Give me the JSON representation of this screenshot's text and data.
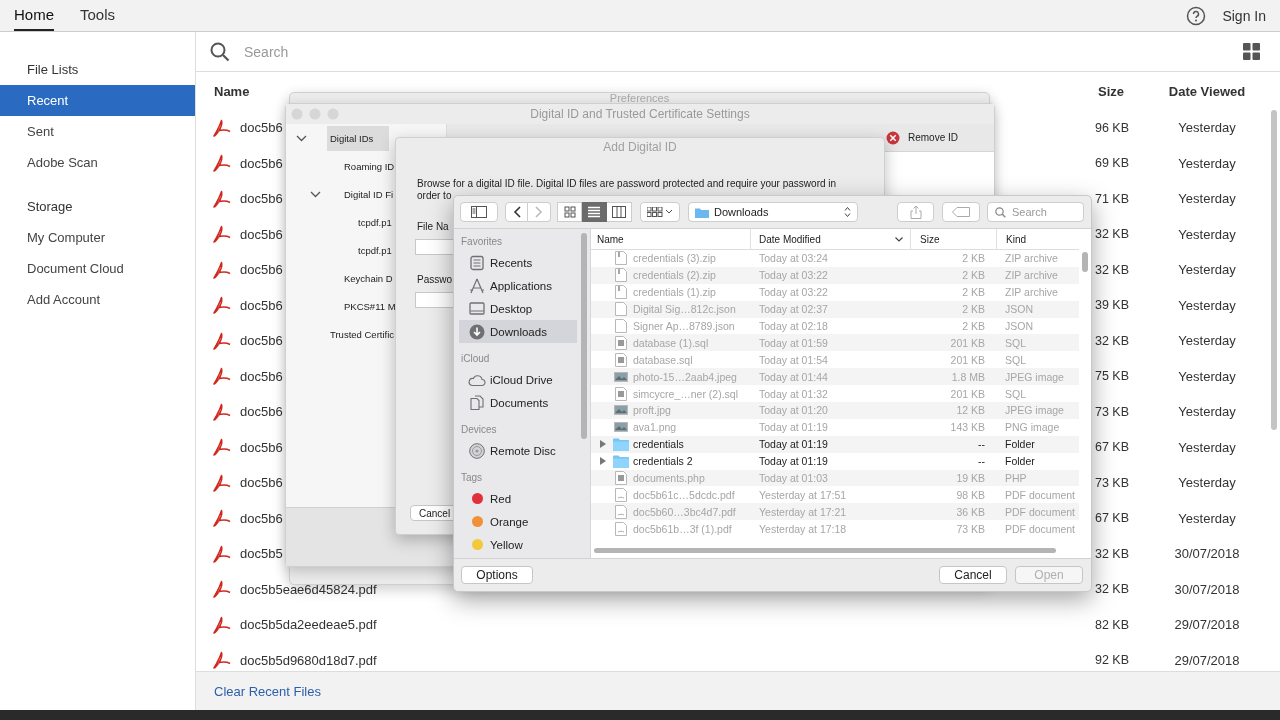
{
  "app": {
    "tabs": [
      {
        "label": "Home",
        "selected": true
      },
      {
        "label": "Tools",
        "selected": false
      }
    ],
    "sign_in": "Sign In"
  },
  "sidebar": {
    "sections": [
      {
        "title": "File Lists",
        "items": [
          {
            "label": "Recent",
            "selected": true
          },
          {
            "label": "Sent",
            "selected": false
          },
          {
            "label": "Adobe Scan",
            "selected": false
          }
        ]
      },
      {
        "title": "Storage",
        "items": [
          {
            "label": "My Computer",
            "selected": false
          },
          {
            "label": "Document Cloud",
            "selected": false
          },
          {
            "label": "Add Account",
            "selected": false
          }
        ]
      }
    ]
  },
  "search": {
    "placeholder": "Search"
  },
  "file_table": {
    "columns": [
      "Name",
      "Size",
      "Date Viewed"
    ],
    "rows": [
      {
        "name": "doc5b6",
        "size": "96 KB",
        "date": "Yesterday"
      },
      {
        "name": "doc5b6",
        "size": "69 KB",
        "date": "Yesterday"
      },
      {
        "name": "doc5b6",
        "size": "71 KB",
        "date": "Yesterday"
      },
      {
        "name": "doc5b6",
        "size": "32 KB",
        "date": "Yesterday"
      },
      {
        "name": "doc5b6",
        "size": "32 KB",
        "date": "Yesterday"
      },
      {
        "name": "doc5b6",
        "size": "39 KB",
        "date": "Yesterday"
      },
      {
        "name": "doc5b6",
        "size": "32 KB",
        "date": "Yesterday"
      },
      {
        "name": "doc5b6",
        "size": "75 KB",
        "date": "Yesterday"
      },
      {
        "name": "doc5b6",
        "size": "73 KB",
        "date": "Yesterday"
      },
      {
        "name": "doc5b6",
        "size": "67 KB",
        "date": "Yesterday"
      },
      {
        "name": "doc5b6",
        "size": "73 KB",
        "date": "Yesterday"
      },
      {
        "name": "doc5b6",
        "size": "67 KB",
        "date": "Yesterday"
      },
      {
        "name": "doc5b5",
        "size": "32 KB",
        "date": "30/07/2018"
      },
      {
        "name": "doc5b5eae6d45824.pdf",
        "size": "32 KB",
        "date": "30/07/2018"
      },
      {
        "name": "doc5b5da2eedeae5.pdf",
        "size": "82 KB",
        "date": "29/07/2018"
      },
      {
        "name": "doc5b5d9680d18d7.pdf",
        "size": "92 KB",
        "date": "29/07/2018"
      }
    ]
  },
  "footer_link": "Clear Recent Files",
  "preferences_window": {
    "title": "Preferences"
  },
  "certificate_window": {
    "title": "Digital ID and Trusted Certificate Settings",
    "toolbar": [
      {
        "label": "Remove ID"
      }
    ],
    "tree": [
      {
        "label": "Digital IDs",
        "selected": true,
        "expanded": true,
        "children": [
          {
            "label": "Roaming ID",
            "selected": false
          },
          {
            "label": "Digital ID Fi",
            "selected": false,
            "expanded": true,
            "children": [
              {
                "label": "tcpdf.p1",
                "selected": false
              },
              {
                "label": "tcpdf.p1",
                "selected": false
              }
            ]
          },
          {
            "label": "Keychain D",
            "selected": false
          },
          {
            "label": "PKCS#11 M",
            "selected": false
          }
        ]
      },
      {
        "label": "Trusted Certific",
        "selected": false
      }
    ]
  },
  "add_id_dialog": {
    "title": "Add Digital ID",
    "description": "Browse for a digital ID file. Digital ID files are password protected and require your password in order to",
    "fields": [
      {
        "label": "File Na"
      },
      {
        "label": "Passwo"
      }
    ],
    "cancel": "Cancel"
  },
  "file_dialog": {
    "views": [
      {
        "kind": "icon",
        "selected": false
      },
      {
        "kind": "list",
        "selected": true
      },
      {
        "kind": "column",
        "selected": false
      }
    ],
    "location": "Downloads",
    "search_placeholder": "Search",
    "sidebar": [
      {
        "title": "Favorites",
        "items": [
          {
            "label": "Recents",
            "kind": "recents",
            "selected": false
          },
          {
            "label": "Applications",
            "kind": "applications",
            "selected": false
          },
          {
            "label": "Desktop",
            "kind": "desktop",
            "selected": false
          },
          {
            "label": "Downloads",
            "kind": "downloads",
            "selected": true
          }
        ]
      },
      {
        "title": "iCloud",
        "items": [
          {
            "label": "iCloud Drive",
            "kind": "cloud",
            "selected": false
          },
          {
            "label": "Documents",
            "kind": "documents",
            "selected": false
          }
        ]
      },
      {
        "title": "Devices",
        "items": [
          {
            "label": "Remote Disc",
            "kind": "disc",
            "selected": false
          }
        ]
      },
      {
        "title": "Tags",
        "items": [
          {
            "label": "Red",
            "kind": "tag",
            "color": "#e0303a",
            "selected": false
          },
          {
            "label": "Orange",
            "kind": "tag",
            "color": "#f0913a",
            "selected": false
          },
          {
            "label": "Yellow",
            "kind": "tag",
            "color": "#f2c93a",
            "selected": false
          }
        ]
      }
    ],
    "columns": [
      {
        "label": "Name",
        "sorted": false
      },
      {
        "label": "Date Modified",
        "sorted": true
      },
      {
        "label": "Size",
        "sorted": false
      },
      {
        "label": "Kind",
        "sorted": false
      }
    ],
    "rows": [
      {
        "name": "credentials (3).zip",
        "date": "Today at 03:24",
        "size": "2 KB",
        "file_kind": "ZIP archive",
        "kind": "archive",
        "enabled": false
      },
      {
        "name": "credentials (2).zip",
        "date": "Today at 03:22",
        "size": "2 KB",
        "file_kind": "ZIP archive",
        "kind": "archive",
        "enabled": false
      },
      {
        "name": "credentials (1).zip",
        "date": "Today at 03:22",
        "size": "2 KB",
        "file_kind": "ZIP archive",
        "kind": "archive",
        "enabled": false
      },
      {
        "name": "Digital Sig…812c.json",
        "date": "Today at 02:37",
        "size": "2 KB",
        "file_kind": "JSON",
        "kind": "blank",
        "enabled": false
      },
      {
        "name": "Signer Ap…8789.json",
        "date": "Today at 02:18",
        "size": "2 KB",
        "file_kind": "JSON",
        "kind": "blank",
        "enabled": false
      },
      {
        "name": "database (1).sql",
        "date": "Today at 01:59",
        "size": "201 KB",
        "file_kind": "SQL",
        "kind": "text",
        "enabled": false
      },
      {
        "name": "database.sql",
        "date": "Today at 01:54",
        "size": "201 KB",
        "file_kind": "SQL",
        "kind": "text",
        "enabled": false
      },
      {
        "name": "photo-15…2aab4.jpeg",
        "date": "Today at 01:44",
        "size": "1.8 MB",
        "file_kind": "JPEG image",
        "kind": "image",
        "enabled": false
      },
      {
        "name": "simcycre_…ner (2).sql",
        "date": "Today at 01:32",
        "size": "201 KB",
        "file_kind": "SQL",
        "kind": "text",
        "enabled": false
      },
      {
        "name": "proft.jpg",
        "date": "Today at 01:20",
        "size": "12 KB",
        "file_kind": "JPEG image",
        "kind": "image",
        "enabled": false
      },
      {
        "name": "ava1.png",
        "date": "Today at 01:19",
        "size": "143 KB",
        "file_kind": "PNG image",
        "kind": "image",
        "enabled": false
      },
      {
        "name": "credentials",
        "date": "Today at 01:19",
        "size": "--",
        "file_kind": "Folder",
        "kind": "folder",
        "enabled": true,
        "expanded": false
      },
      {
        "name": "credentials 2",
        "date": "Today at 01:19",
        "size": "--",
        "file_kind": "Folder",
        "kind": "folder",
        "enabled": true,
        "expanded": false
      },
      {
        "name": "documents.php",
        "date": "Today at 01:03",
        "size": "19 KB",
        "file_kind": "PHP",
        "kind": "text",
        "enabled": false
      },
      {
        "name": "doc5b61c…5dcdc.pdf",
        "date": "Yesterday at 17:51",
        "size": "98 KB",
        "file_kind": "PDF document",
        "kind": "pdf",
        "enabled": false
      },
      {
        "name": "doc5b60…3bc4d7.pdf",
        "date": "Yesterday at 17:21",
        "size": "36 KB",
        "file_kind": "PDF document",
        "kind": "pdf",
        "enabled": false
      },
      {
        "name": "doc5b61b…3f (1).pdf",
        "date": "Yesterday at 17:18",
        "size": "73 KB",
        "file_kind": "PDF document",
        "kind": "pdf",
        "enabled": false
      }
    ],
    "options": "Options",
    "cancel": "Cancel",
    "open": {
      "label": "Open",
      "disabled": true
    }
  }
}
